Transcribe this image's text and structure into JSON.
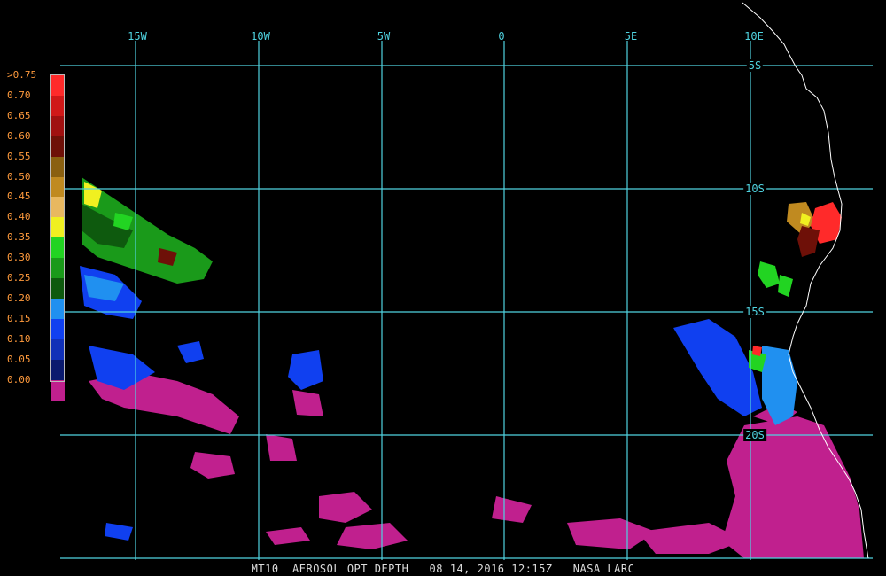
{
  "map": {
    "lon_labels": [
      "15W",
      "10W",
      "5W",
      "0",
      "5E",
      "10E"
    ],
    "lat_labels": [
      "5S",
      "10S",
      "15S",
      "20S"
    ],
    "grid_color": "#4fd3e0",
    "coast_color": "#ffffff"
  },
  "legend": {
    "label_color": "#ff9a3c",
    "entries": [
      {
        "label": ">0.75",
        "color": "#ff2a2a"
      },
      {
        "label": "0.70",
        "color": "#d01818"
      },
      {
        "label": "0.65",
        "color": "#a01010"
      },
      {
        "label": "0.60",
        "color": "#6e1008"
      },
      {
        "label": "0.55",
        "color": "#8a6010"
      },
      {
        "label": "0.50",
        "color": "#c08a20"
      },
      {
        "label": "0.45",
        "color": "#e8b860"
      },
      {
        "label": "0.40",
        "color": "#f0f020"
      },
      {
        "label": "0.35",
        "color": "#22d422"
      },
      {
        "label": "0.30",
        "color": "#1a9a1a"
      },
      {
        "label": "0.25",
        "color": "#0e5a0e"
      },
      {
        "label": "0.20",
        "color": "#2090f0"
      },
      {
        "label": "0.15",
        "color": "#1040f0"
      },
      {
        "label": "0.10",
        "color": "#1030b8"
      },
      {
        "label": "0.05",
        "color": "#0a1a6e"
      },
      {
        "label": "0.00",
        "color": "#c0208e"
      }
    ]
  },
  "footer": {
    "product": "MT10",
    "parameter": "AEROSOL OPT DEPTH",
    "datetime": "08 14, 2016 12:15Z",
    "source": "NASA LARC"
  }
}
